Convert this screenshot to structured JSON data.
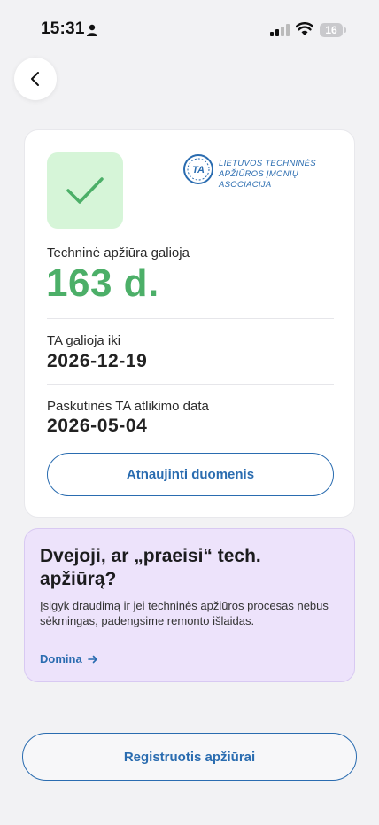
{
  "status_bar": {
    "time": "15:31",
    "battery": "16",
    "icons": [
      "person-icon",
      "signal-icon",
      "wifi-icon",
      "battery-icon"
    ]
  },
  "nav": {
    "back_icon": "chevron-left-icon"
  },
  "card": {
    "association_line1": "LIETUVOS TECHNINĖS",
    "association_line2": "APŽIŪROS ĮMONIŲ ASOCIACIJA",
    "association_logo_text": "TA",
    "status_label": "Techninė apžiūra galioja",
    "status_value": "163 d.",
    "valid_until_label": "TA galioja iki",
    "valid_until_value": "2026-12-19",
    "last_inspection_label": "Paskutinės TA atlikimo data",
    "last_inspection_value": "2026-05-04",
    "refresh_button": "Atnaujinti duomenis"
  },
  "promo": {
    "title": "Dvejoji, ar „praeisi“ tech. apžiūrą?",
    "text": "Įsigyk draudimą ir jei techninės apžiūros procesas nebus sėkmingas, padengsime remonto išlaidas.",
    "link": "Domina"
  },
  "register_button": "Registruotis apžiūrai",
  "colors": {
    "accent": "#2a6cb0",
    "success": "#4caf68",
    "success_bg": "#d6f5d8",
    "promo_bg": "#ede3fb"
  }
}
